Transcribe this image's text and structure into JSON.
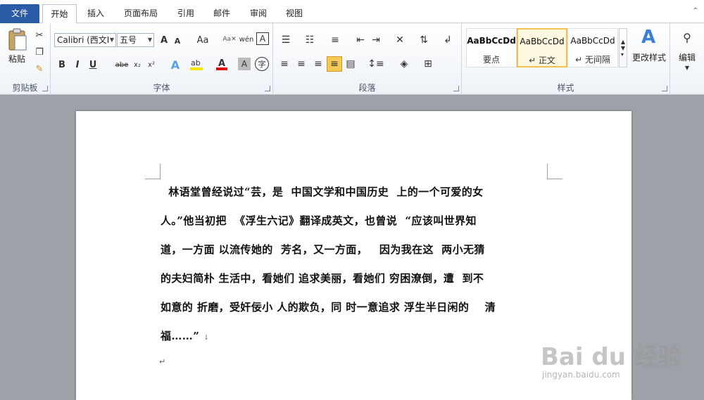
{
  "tabs": {
    "file": "文件",
    "home": "开始",
    "insert": "插入",
    "layout": "页面布局",
    "references": "引用",
    "mailings": "邮件",
    "review": "审阅",
    "view": "视图"
  },
  "ribbon": {
    "clipboard": {
      "label": "剪贴板",
      "paste": "粘贴"
    },
    "font": {
      "label": "字体",
      "font_name": "Calibri (西文I",
      "font_size": "五号",
      "grow": "A",
      "shrink": "A",
      "case": "Aa",
      "bold": "B",
      "italic": "I",
      "underline": "U",
      "strike": "abe",
      "sub": "x₂",
      "sup": "x²",
      "wen": "wén",
      "char_border": "A",
      "char_shade": "A",
      "enclose": "字"
    },
    "paragraph": {
      "label": "段落"
    },
    "styles": {
      "label": "样式",
      "items": [
        {
          "sample": "AaBbCcDd",
          "name": "要点"
        },
        {
          "sample": "AaBbCcDd",
          "name": "↵ 正文"
        },
        {
          "sample": "AaBbCcDd",
          "name": "↵ 无间隔"
        }
      ],
      "change_styles": "更改样式"
    },
    "editing": {
      "label": "编辑"
    }
  },
  "document": {
    "lines": [
      "  林语堂曾经说过“芸，是  中国文学和中国历史  上的一个可爱的女",
      "人。”他当初把  《浮生六记》翻译成英文，也曾说  “应该叫世界知",
      "道，一方面 以流传她的  芳名，又一方面，   因为我在这  两小无猜",
      "的夫妇简朴 生活中，看她们 追求美丽，看她们 穷困潦倒，遭  到不",
      "如意的 折磨，受奸佞小 人的欺负，同 时一意追求 浮生半日闲的    清",
      "福……”"
    ],
    "line_break_mark": "↓",
    "para_mark": "↵"
  },
  "watermark": {
    "brand": "Bai du 经验",
    "url": "jingyan.baidu.com"
  }
}
